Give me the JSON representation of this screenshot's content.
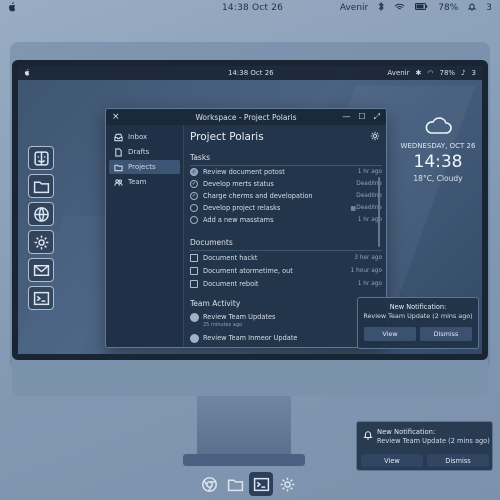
{
  "system_bar": {
    "clock": "14:38   Oct 26",
    "user": "Avenir",
    "battery": "78%",
    "notifications_count": "3"
  },
  "inner_bar": {
    "clock": "14:38   Oct 26",
    "user": "Avenir",
    "battery": "78%",
    "notifications_count": "3"
  },
  "left_dock": [
    "finder-icon",
    "folder-icon",
    "globe-icon",
    "gear-icon",
    "mail-icon",
    "terminal-icon"
  ],
  "window": {
    "title": "Workspace - Project Polaris",
    "sidebar": [
      {
        "label": "Inbox",
        "icon": "inbox-icon"
      },
      {
        "label": "Drafts",
        "icon": "file-icon"
      },
      {
        "label": "Projects",
        "icon": "folder-icon",
        "selected": true
      },
      {
        "label": "Team",
        "icon": "team-icon"
      }
    ],
    "project_title": "Project Polaris",
    "tasks_header": "Tasks",
    "tasks": [
      {
        "label": "Review document potost",
        "meta": "1 hr ago",
        "done": true
      },
      {
        "label": "Develop merts status",
        "meta": "Deadline",
        "done": false
      },
      {
        "label": "Charge cherms and developation",
        "meta": "Deadline",
        "done": false
      },
      {
        "label": "Develop project relasks",
        "meta": "Deadline",
        "done": false,
        "calendar": true
      },
      {
        "label": "Add a new masstams",
        "meta": "1 hr ago",
        "done": false
      }
    ],
    "documents_header": "Documents",
    "documents": [
      {
        "label": "Document hackt",
        "meta": "3 her ago"
      },
      {
        "label": "Document atormetime, out",
        "meta": "1 hour ago"
      },
      {
        "label": "Document reboit",
        "meta": "1 hr ago"
      }
    ],
    "activity_header": "Team Activity",
    "activity": [
      {
        "label": "Review Team Updates",
        "sub": "25 minutes ago"
      },
      {
        "label": "Review Team Inmeor Update",
        "sub": ""
      }
    ]
  },
  "widget": {
    "date": "WEDNESDAY, OCT 26",
    "time": "14:38",
    "weather": "18°C, Cloudy"
  },
  "notification_inner": {
    "title": "New Notification:",
    "body": "Review Team Update (2 mins ago)",
    "view": "View",
    "dismiss": "Dismiss"
  },
  "bottom_dock": [
    "chrome-icon",
    "folder-icon",
    "terminal-icon",
    "gear-icon"
  ],
  "notification_outer": {
    "title": "New Notification:",
    "body": "Review Team Update (2 mins ago)",
    "view": "View",
    "dismiss": "Dismiss"
  }
}
